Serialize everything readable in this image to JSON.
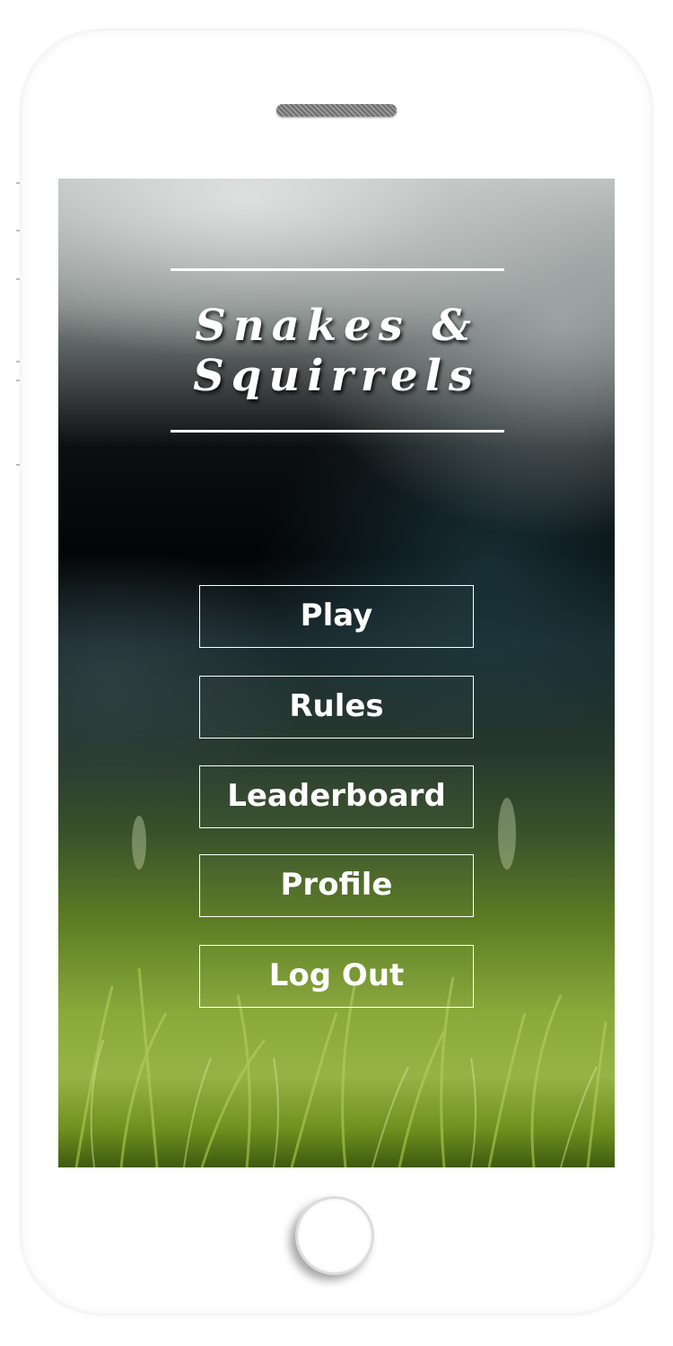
{
  "app": {
    "title_line_1": "Snakes &",
    "title_line_2": "Squirrels"
  },
  "menu": {
    "items": [
      {
        "id": "play",
        "label": "Play"
      },
      {
        "id": "rules",
        "label": "Rules"
      },
      {
        "id": "leaderboard",
        "label": "Leaderboard"
      },
      {
        "id": "profile",
        "label": "Profile"
      },
      {
        "id": "log-out",
        "label": "Log Out"
      }
    ]
  },
  "colors": {
    "text": "#ffffff",
    "button_border": "#ffffff",
    "phone_body": "#ffffff"
  },
  "icons": {
    "speaker": "speaker-grille-icon",
    "home": "home-button-icon"
  }
}
